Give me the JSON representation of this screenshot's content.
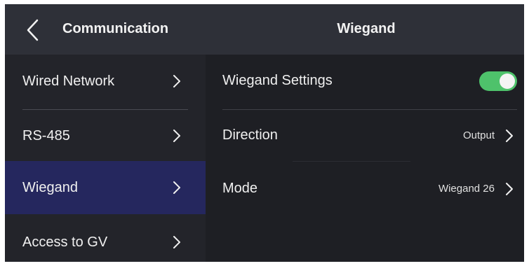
{
  "header": {
    "back_icon": "chevron-left-icon",
    "left_title": "Communication",
    "center_title": "Wiegand"
  },
  "sidebar": {
    "items": [
      {
        "label": "Wired Network",
        "active": false
      },
      {
        "label": "RS-485",
        "active": false
      },
      {
        "label": "Wiegand",
        "active": true
      },
      {
        "label": "Access to GV",
        "active": false
      }
    ]
  },
  "content": {
    "wiegand_settings": {
      "label": "Wiegand Settings",
      "enabled": true
    },
    "direction": {
      "label": "Direction",
      "value": "Output"
    },
    "mode": {
      "label": "Mode",
      "value": "Wiegand 26"
    }
  },
  "colors": {
    "background": "#1e1f24",
    "header": "#2e3038",
    "active_item": "#25275e",
    "toggle_on": "#4ec26b"
  }
}
